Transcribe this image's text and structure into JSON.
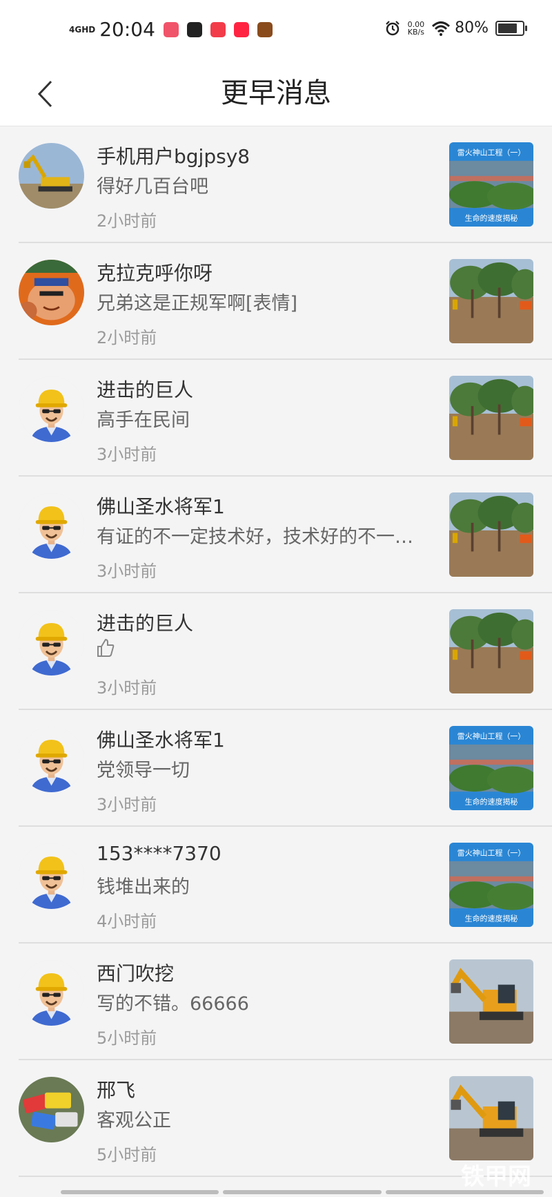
{
  "status_bar": {
    "network": "4GHD",
    "time": "20:04",
    "speed_value": "0.00",
    "speed_unit": "KB/s",
    "battery": "80%",
    "battery_level": 0.8,
    "app_icons": [
      {
        "icon": "app-icon-video",
        "color": "#f0546a"
      },
      {
        "icon": "app-icon-shield",
        "color": "#222222"
      },
      {
        "icon": "app-icon-heart",
        "color": "#f23c4a"
      },
      {
        "icon": "app-icon-xiaohongshu",
        "color": "#ff2442"
      },
      {
        "icon": "app-icon-game",
        "color": "#8a4b1c"
      }
    ],
    "right_icons": [
      "alarm-icon",
      "wifi-icon",
      "battery-icon"
    ]
  },
  "header": {
    "title": "更早消息",
    "back_icon": "chevron-left-icon"
  },
  "messages": [
    {
      "name": "手机用户bgjpsy8",
      "content": "得好几百台吧",
      "time": "2小时前",
      "avatar": "excavator-photo",
      "thumb": "banner-thumb",
      "thumb_title": "雷火神山工程（一）",
      "thumb_footer": "生命的速度揭秘"
    },
    {
      "name": "克拉克呼你呀",
      "content": "兄弟这是正规军啊[表情]",
      "time": "2小时前",
      "avatar": "cartoon-avatar",
      "thumb": "forest-thumb"
    },
    {
      "name": "进击的巨人",
      "content": "高手在民间",
      "time": "3小时前",
      "avatar": "worker-avatar",
      "thumb": "forest-thumb"
    },
    {
      "name": "佛山圣水将军1",
      "content": "有证的不一定技术好，技术好的不一…",
      "time": "3小时前",
      "avatar": "worker-avatar",
      "thumb": "forest-thumb"
    },
    {
      "name": "进击的巨人",
      "content": "",
      "content_icon": "thumbs-up-icon",
      "time": "3小时前",
      "avatar": "worker-avatar",
      "thumb": "forest-thumb"
    },
    {
      "name": "佛山圣水将军1",
      "content": "党领导一切",
      "time": "3小时前",
      "avatar": "worker-avatar",
      "thumb": "banner-thumb",
      "thumb_title": "雷火神山工程（一）",
      "thumb_footer": "生命的速度揭秘"
    },
    {
      "name": "153****7370",
      "content": "钱堆出来的",
      "time": "4小时前",
      "avatar": "worker-avatar",
      "thumb": "banner-thumb",
      "thumb_title": "雷火神山工程（一）",
      "thumb_footer": "生命的速度揭秘"
    },
    {
      "name": "西门吹挖",
      "content": "写的不错。66666",
      "time": "5小时前",
      "avatar": "worker-avatar",
      "thumb": "excavator-thumb"
    },
    {
      "name": "邢飞",
      "content": "客观公正",
      "time": "5小时前",
      "avatar": "cards-photo",
      "thumb": "excavator-thumb"
    }
  ],
  "watermark": "铁甲网",
  "colors": {
    "background": "#f4f4f5",
    "divider": "#dedede",
    "name": "#333333",
    "content": "#666666",
    "time": "#9a9a9a"
  }
}
